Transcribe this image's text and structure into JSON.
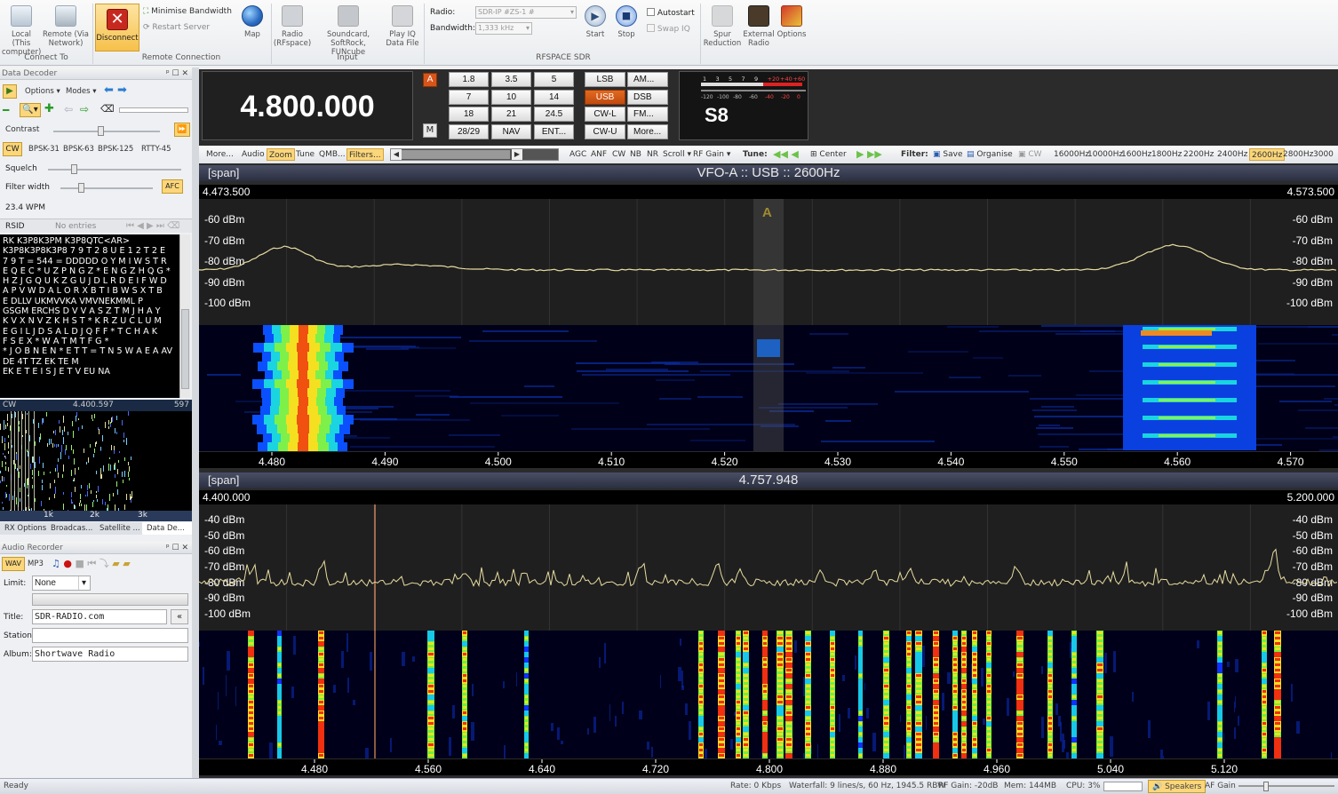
{
  "ribbon": {
    "connect_to": {
      "local": "Local (This computer)",
      "remote": "Remote (Via Network)",
      "group": "Connect To"
    },
    "remote_connection": {
      "disconnect": "Disconnect",
      "minimise": "Minimise Bandwidth",
      "restart": "Restart Server",
      "map": "Map",
      "group": "Remote Connection"
    },
    "input": {
      "radio": "Radio (RFspace)",
      "soundcard": "Soundcard, SoftRock, FUNcube",
      "playiq": "Play IQ Data File",
      "group": "Input"
    },
    "rfspace": {
      "radio_label": "Radio:",
      "radio_value": "SDR-IP #ZS-1 #",
      "bandwidth_label": "Bandwidth:",
      "bandwidth_value": "1,333 kHz",
      "start": "Start",
      "stop": "Stop",
      "autostart": "Autostart",
      "swapiq": "Swap IQ",
      "group": "RFSPACE SDR"
    },
    "spur": "Spur Reduction",
    "external": "External Radio",
    "options": "Options"
  },
  "decoder": {
    "title": "Data Decoder",
    "options": "Options",
    "modes": "Modes",
    "contrast": "Contrast",
    "modes_list": [
      "CW",
      "BPSK-31",
      "BPSK-63",
      "BPSK-125",
      "RTTY-45"
    ],
    "squelch": "Squelch",
    "filter_width": "Filter width",
    "afc": "AFC",
    "wpm": "23.4 WPM",
    "rsid": "RSID",
    "rsid_entries": "No entries",
    "text": [
      "RK K3P8K3PM K3P8QTC<AR>",
      "K3P8K3P8K3P8 7 9 T 2 8 U E 1 2 T 2 E",
      "7 9 T = 544 = DDDDD O Y  M I W S T R",
      "E Q E C * U Z P N G Z * E N G Z H Q G *",
      "H Z J G Q U K Z G U J D L R D E I F W D",
      "A P V W D A L O R X B T I B W S  X T B",
      "E DLLV UKMVVKA VMVNEKMML P",
      "GSGM ERCHS D V V A S Z T M J H A Y",
      "K V X N V Z K H S T * K R Z U C L U M",
      "E G I L J D S A L D J Q F F * T C  H A K",
      "F S E X * W A T M T F G *",
      "* J O B N E N * E T T = T N 5 W A E A AV",
      "DE 4T TZ EK TE M",
      "EK E T E I S J E T V EU NA"
    ],
    "cw_label": "CW",
    "cw_freq": "4.400.597",
    "cw_right": "597",
    "cw_ticks": [
      "1k",
      "2k",
      "3k"
    ],
    "tabs": [
      "RX Options",
      "Broadcas...",
      "Satellite ...",
      "Data De..."
    ]
  },
  "recorder": {
    "title": "Audio Recorder",
    "wav": "WAV",
    "mp3": "MP3",
    "limit_label": "Limit:",
    "limit_value": "None",
    "title_label": "Title:",
    "title_value": "SDR-RADIO.com",
    "station_label": "Station:",
    "album_label": "Album:",
    "album_value": "Shortwave Radio"
  },
  "vfo": {
    "frequency": "4.800.000",
    "a": "A",
    "m": "M",
    "bands": [
      "1.8",
      "3.5",
      "5",
      "7",
      "10",
      "14",
      "18",
      "21",
      "24.5",
      "28/29",
      "NAV",
      "ENT..."
    ],
    "modes": [
      "LSB",
      "AM...",
      "USB",
      "DSB",
      "CW-L",
      "FM...",
      "CW-U",
      "More..."
    ],
    "active_mode": "USB",
    "smeter": "S8",
    "smeter_scale": [
      "1",
      "3",
      "5",
      "7",
      "9",
      "+20",
      "+40",
      "+60"
    ],
    "smeter_dbm": [
      "-120",
      "-100",
      "-80",
      "-60",
      "-40",
      "-20",
      "0"
    ]
  },
  "toolbar": {
    "more": "More...",
    "audio": "Audio",
    "zoom": "Zoom",
    "tune": "Tune",
    "qmb": "QMB...",
    "filters": "Filters...",
    "agc": "AGC",
    "anf": "ANF",
    "cw": "CW",
    "nb": "NB",
    "nr": "NR",
    "scroll": "Scroll",
    "rfgain": "RF Gain",
    "tune2": "Tune:",
    "center": "Center",
    "filter_label": "Filter:",
    "save": "Save",
    "organise": "Organise",
    "cw2": "CW",
    "filters_list": [
      "16000Hz",
      "10000Hz",
      "1600Hz",
      "1800Hz",
      "2200Hz",
      "2400Hz",
      "2600Hz",
      "2800Hz",
      "3000"
    ],
    "active_filter": "2600Hz"
  },
  "top_panel": {
    "span": "[span]",
    "title": "VFO-A  ::  USB  ::  2600Hz",
    "left": "4.473.500",
    "right": "4.573.500",
    "dbm": [
      "-60 dBm",
      "-70 dBm",
      "-80 dBm",
      "-90 dBm",
      "-100 dBm"
    ],
    "ticks": [
      "4.480",
      "4.490",
      "4.500",
      "4.510",
      "4.520",
      "4.530",
      "4.540",
      "4.550",
      "4.560",
      "4.570"
    ],
    "marker": "A"
  },
  "bottom_panel": {
    "span": "[span]",
    "title": "4.757.948",
    "left": "4.400.000",
    "right": "5.200.000",
    "dbm": [
      "-40 dBm",
      "-50 dBm",
      "-60 dBm",
      "-70 dBm",
      "-80 dBm",
      "-90 dBm",
      "-100 dBm"
    ],
    "ticks": [
      "4.480",
      "4.560",
      "4.640",
      "4.720",
      "4.800",
      "4.880",
      "4.960",
      "5.040",
      "5.120"
    ]
  },
  "status": {
    "ready": "Ready",
    "rate": "Rate: 0 Kbps",
    "waterfall": "Waterfall: 9 lines/s, 60 Hz, 1945.5 RBW",
    "rfgain": "RF Gain: -20dB",
    "mem": "Mem: 144MB",
    "cpu": "CPU: 3%",
    "speakers": "Speakers",
    "afgain": "AF Gain"
  }
}
